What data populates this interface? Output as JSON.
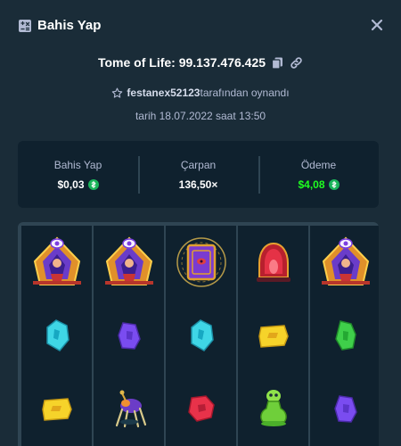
{
  "header": {
    "title": "Bahis Yap",
    "icon": "bet-slip-icon",
    "close_icon": "close-icon"
  },
  "bet": {
    "game_and_id": "Tome of Life: 99.137.476.425",
    "player": "festanex52123",
    "played_by_suffix": "tarafından oynandı",
    "date_text": "tarih 18.07.2022 saat 13:50"
  },
  "stats": {
    "bet_label": "Bahis Yap",
    "bet_value": "$0,03",
    "multiplier_label": "Çarpan",
    "multiplier_value": "136,50×",
    "payout_label": "Ödeme",
    "payout_value": "$4,08"
  },
  "colors": {
    "background": "#1a2c38",
    "panel": "#0f212e",
    "divider": "#2f4553",
    "payout_green": "#1fff20",
    "coin": "#1ab45a"
  },
  "reels": [
    [
      "wizard-symbol",
      "cyan-gem-symbol",
      "yellow-gem-symbol"
    ],
    [
      "wizard-symbol",
      "purple-gem-symbol",
      "spider-symbol"
    ],
    [
      "tome-symbol",
      "cyan-gem-symbol",
      "red-gem-symbol"
    ],
    [
      "red-crystal-symbol",
      "yellow-gem-symbol",
      "green-potion-symbol"
    ],
    [
      "wizard-symbol",
      "green-gem-symbol",
      "purple-gem-symbol"
    ]
  ]
}
